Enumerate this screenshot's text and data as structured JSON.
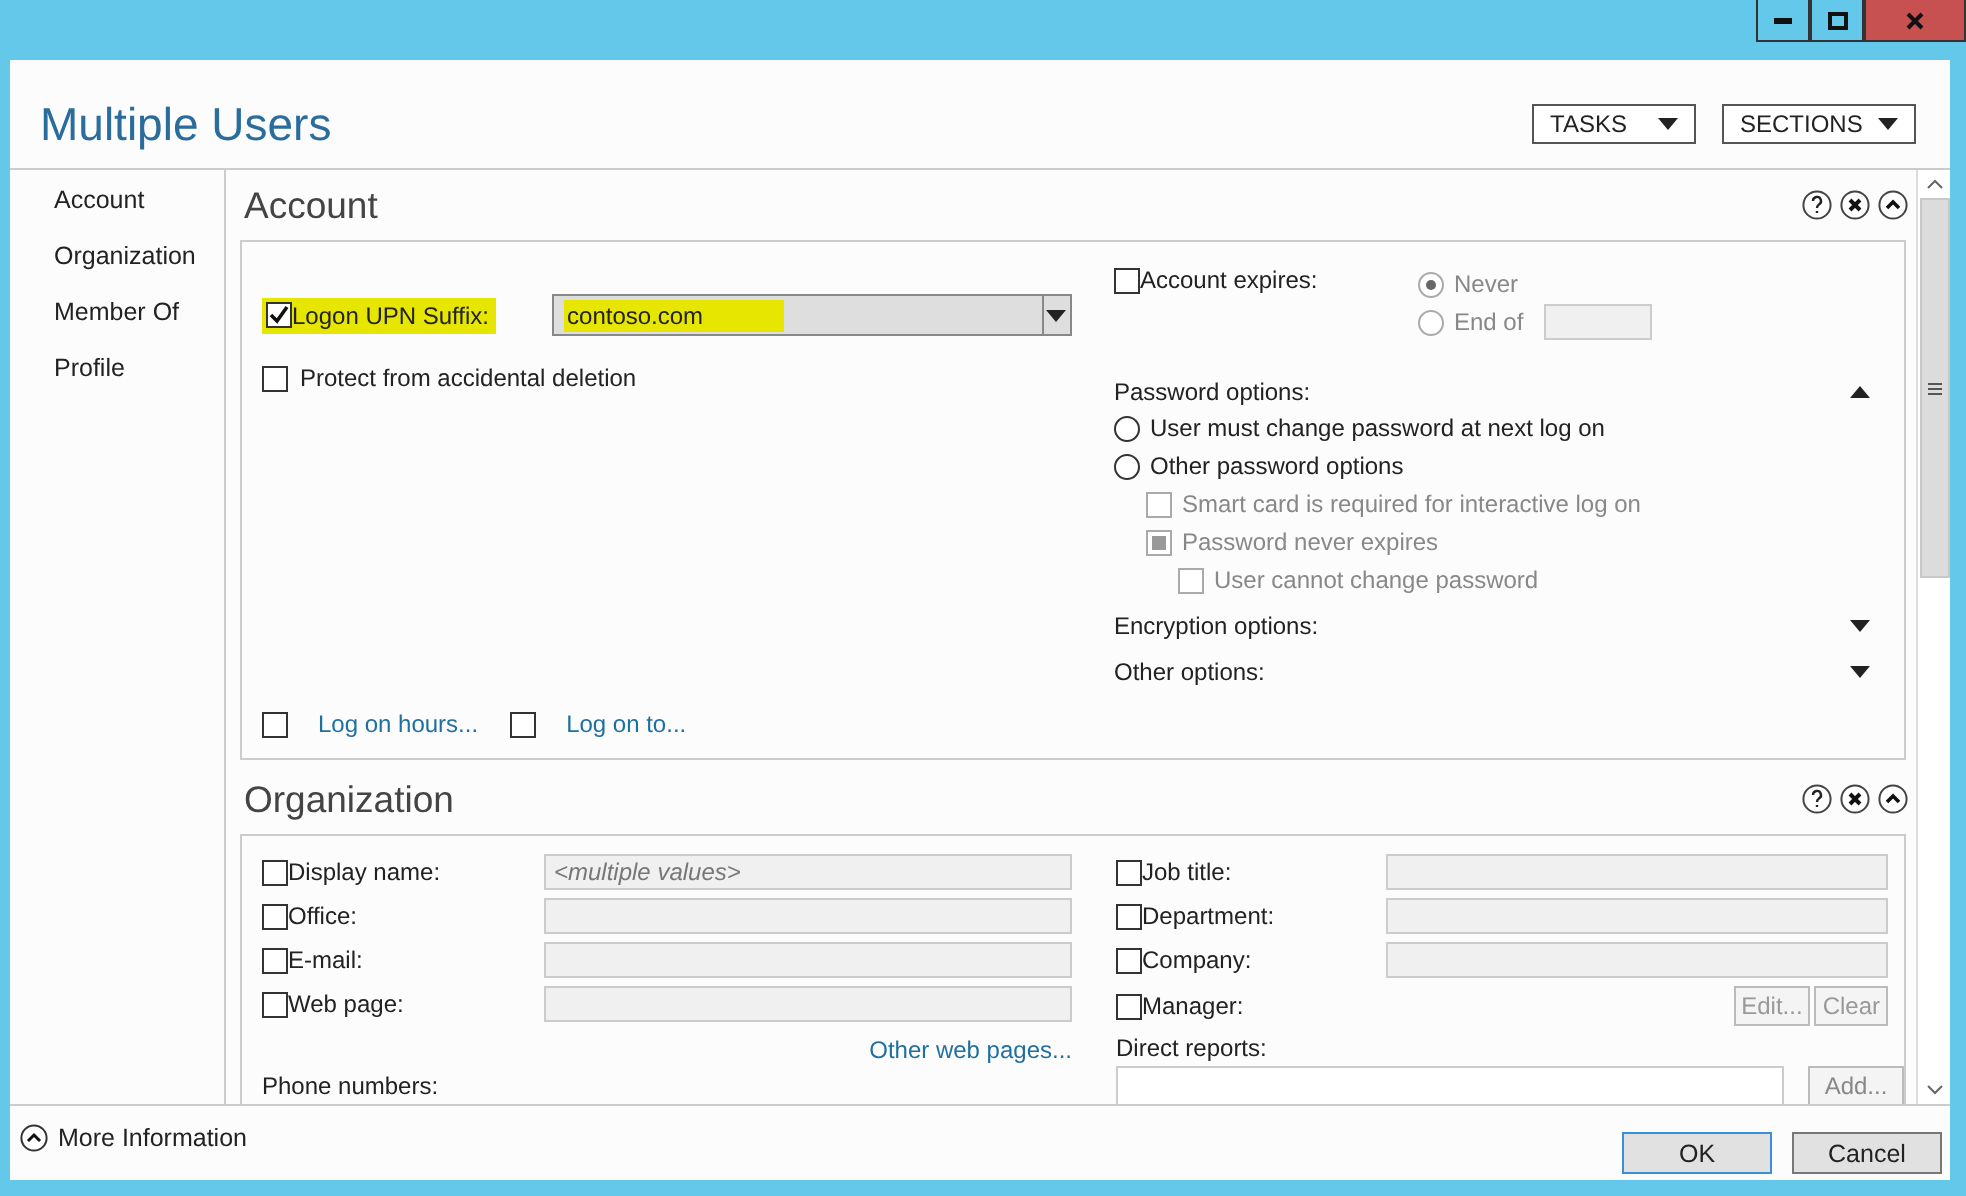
{
  "title": "Multiple Users",
  "header_buttons": [
    {
      "label": "TASKS"
    },
    {
      "label": "SECTIONS"
    }
  ],
  "sidebar": {
    "items": [
      "Account",
      "Organization",
      "Member Of",
      "Profile"
    ]
  },
  "account": {
    "title": "Account",
    "upn": {
      "label": "Logon UPN Suffix:",
      "checked": true,
      "value": "contoso.com",
      "highlighted": true
    },
    "protect": {
      "label": "Protect from accidental deletion",
      "checked": false
    },
    "links": [
      {
        "label": "Log on hours...",
        "checked": false
      },
      {
        "label": "Log on to...",
        "checked": false
      }
    ],
    "expires": {
      "label": "Account expires:",
      "checked": false,
      "options": [
        {
          "label": "Never",
          "selected": true,
          "disabled": true
        },
        {
          "label": "End of",
          "selected": false,
          "disabled": true
        }
      ]
    },
    "password_options": {
      "label": "Password options:",
      "expanded": true,
      "radios": [
        {
          "label": "User must change password at next log on",
          "selected": false
        },
        {
          "label": "Other password options",
          "selected": false
        }
      ],
      "checks": [
        {
          "label": "Smart card is required for interactive log on",
          "checked": false,
          "indeterminate": false,
          "disabled": true
        },
        {
          "label": "Password never expires",
          "checked": false,
          "indeterminate": true,
          "disabled": true,
          "children": [
            {
              "label": "User cannot change password",
              "checked": false,
              "indeterminate": false,
              "disabled": true
            }
          ]
        }
      ]
    },
    "collapsibles": [
      {
        "label": "Encryption options:",
        "expanded": false
      },
      {
        "label": "Other options:",
        "expanded": false
      }
    ]
  },
  "organization": {
    "title": "Organization",
    "left_fields": [
      {
        "label": "Display name:",
        "checked": false,
        "placeholder": "<multiple values>"
      },
      {
        "label": "Office:",
        "checked": false
      },
      {
        "label": "E-mail:",
        "checked": false
      },
      {
        "label": "Web page:",
        "checked": false
      }
    ],
    "link": "Other web pages...",
    "phone_label": "Phone numbers:",
    "right_fields": [
      {
        "label": "Job title:",
        "checked": false
      },
      {
        "label": "Department:",
        "checked": false
      },
      {
        "label": "Company:",
        "checked": false
      }
    ],
    "manager": {
      "label": "Manager:",
      "checked": false,
      "buttons": [
        "Edit...",
        "Clear"
      ]
    },
    "direct_reports": {
      "label": "Direct reports:",
      "button": "Add..."
    }
  },
  "footer": {
    "more_info": "More Information",
    "buttons": [
      {
        "label": "OK",
        "default": true
      },
      {
        "label": "Cancel",
        "default": false
      }
    ]
  }
}
